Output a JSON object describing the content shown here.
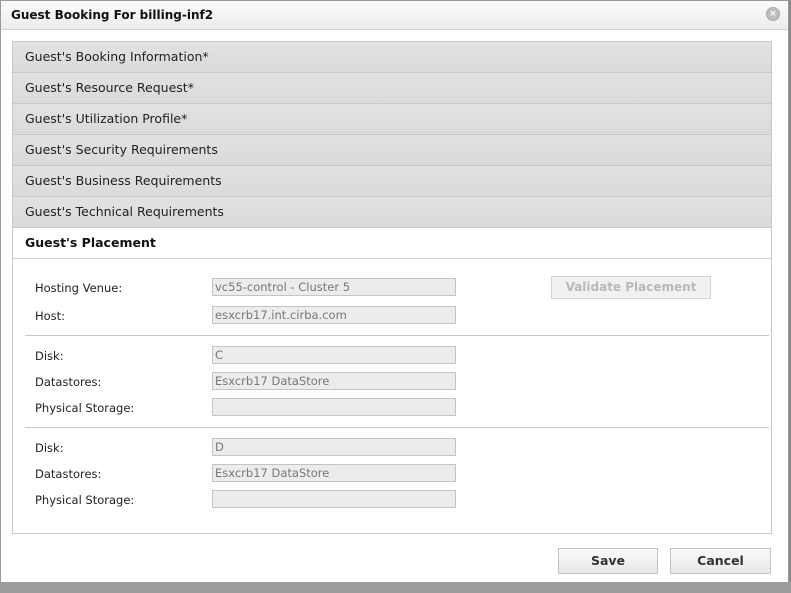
{
  "dialog": {
    "title": "Guest Booking For billing-inf2",
    "close_glyph": "×"
  },
  "accordion": {
    "items": [
      {
        "label": "Guest's Booking Information*"
      },
      {
        "label": "Guest's Resource Request*"
      },
      {
        "label": "Guest's Utilization Profile*"
      },
      {
        "label": "Guest's Security Requirements"
      },
      {
        "label": "Guest's Business Requirements"
      },
      {
        "label": "Guest's Technical Requirements"
      }
    ],
    "active_label": "Guest's Placement"
  },
  "placement": {
    "hosting_venue_label": "Hosting Venue:",
    "hosting_venue_value": "vc55-control - Cluster 5",
    "host_label": "Host:",
    "host_value": "esxcrb17.int.cirba.com",
    "validate_label": "Validate Placement",
    "disks": [
      {
        "disk_label": "Disk:",
        "disk_value": "C",
        "datastores_label": "Datastores:",
        "datastores_value": "Esxcrb17 DataStore",
        "physical_label": "Physical Storage:",
        "physical_value": ""
      },
      {
        "disk_label": "Disk:",
        "disk_value": "D",
        "datastores_label": "Datastores:",
        "datastores_value": "Esxcrb17 DataStore",
        "physical_label": "Physical Storage:",
        "physical_value": ""
      }
    ]
  },
  "footer": {
    "save_label": "Save",
    "cancel_label": "Cancel"
  }
}
